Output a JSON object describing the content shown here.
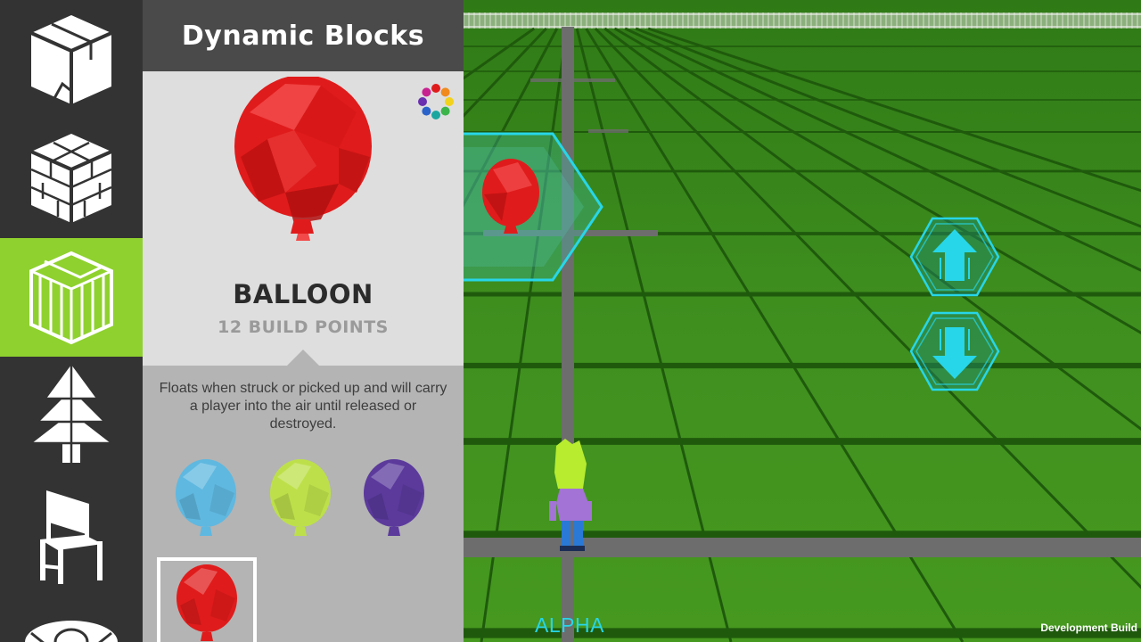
{
  "panel": {
    "title": "Dynamic Blocks",
    "block_name": "BALLOON",
    "build_points": "12 BUILD POINTS",
    "description": "Floats when struck or picked up and will carry a player into the air until released or destroyed."
  },
  "categories": [
    {
      "name": "boxes-category",
      "icon": "box-icon",
      "active": false
    },
    {
      "name": "bricks-category",
      "icon": "brick-cube-icon",
      "active": false
    },
    {
      "name": "dynamic-blocks-category",
      "icon": "dynamic-block-icon",
      "active": true
    },
    {
      "name": "nature-category",
      "icon": "tree-icon",
      "active": false
    },
    {
      "name": "furniture-category",
      "icon": "chair-icon",
      "active": false
    },
    {
      "name": "tools-category",
      "icon": "cannon-icon",
      "active": false
    }
  ],
  "variants": [
    {
      "name": "balloon-blue",
      "color": "#5fb8e0",
      "selected": false
    },
    {
      "name": "balloon-lime",
      "color": "#bde04a",
      "selected": false
    },
    {
      "name": "balloon-purple",
      "color": "#5b3a9c",
      "selected": false
    },
    {
      "name": "balloon-red",
      "color": "#e01b1b",
      "selected": true
    }
  ],
  "palette_colors": [
    "#e01b1b",
    "#f08a1e",
    "#f2d21b",
    "#3bb54a",
    "#1aa6a0",
    "#2a63c9",
    "#6a2fb0",
    "#c8218f"
  ],
  "hud": {
    "alpha_label": "ALPHA",
    "dev_build_label": "Development Build",
    "raise_icon": "arrow-up-icon",
    "lower_icon": "arrow-down-icon"
  },
  "colors": {
    "accent": "#8fd12e",
    "hud_cyan": "#27d6e8",
    "grass": "#3f8a1e",
    "balloon_red": "#e01b1b"
  }
}
